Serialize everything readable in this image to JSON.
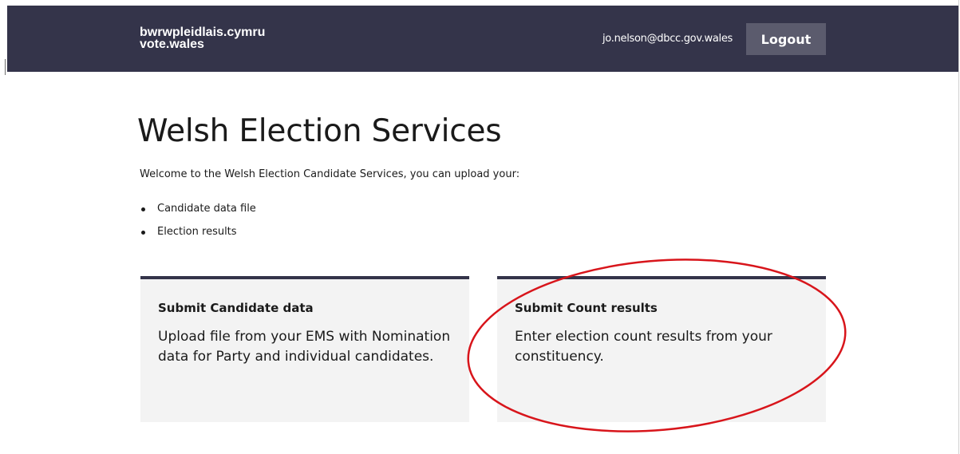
{
  "header": {
    "logo_line1": "bwrwpleidlais.cymru",
    "logo_line2": "vote.wales",
    "user_email": "jo.nelson@dbcc.gov.wales",
    "logout_label": "Logout",
    "bg_color": "#34344a",
    "button_color": "#5b5b6d"
  },
  "main": {
    "title": "Welsh Election Services",
    "intro": "Welcome to the Welsh Election Candidate Services, you can upload your:",
    "upload_items": [
      "Candidate data file",
      "Election results"
    ]
  },
  "cards": [
    {
      "title": "Submit Candidate data",
      "description": "Upload file from your EMS with Nomination data for Party and individual candidates."
    },
    {
      "title": "Submit Count results",
      "description": "Enter election count results from your constituency."
    }
  ],
  "annotation": {
    "shape": "ellipse",
    "color": "#d8151b",
    "highlights": "Submit Count results card"
  }
}
